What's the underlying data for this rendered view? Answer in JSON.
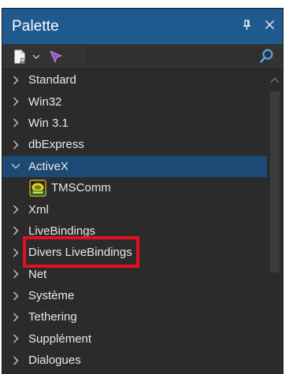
{
  "palette": {
    "title": "Palette",
    "pin_glyph": "4",
    "close_glyph": "✕"
  },
  "toolbar": {
    "icons": [
      "new-page-icon",
      "chevron-down-icon",
      "cursor-arrow-icon",
      "search-icon"
    ],
    "search_value": ""
  },
  "tree": {
    "items": [
      {
        "label": "Standard",
        "expanded": false
      },
      {
        "label": "Win32",
        "expanded": false
      },
      {
        "label": "Win 3.1",
        "expanded": false
      },
      {
        "label": "dbExpress",
        "expanded": false
      },
      {
        "label": "ActiveX",
        "expanded": true,
        "selected": true
      },
      {
        "label": "TMSComm",
        "child": true,
        "icon": "tms-comm-component-icon"
      },
      {
        "label": "Xml",
        "expanded": false
      },
      {
        "label": "LiveBindings",
        "expanded": false
      },
      {
        "label": "Divers LiveBindings",
        "expanded": false
      },
      {
        "label": "Net",
        "expanded": false
      },
      {
        "label": "Système",
        "expanded": false
      },
      {
        "label": "Tethering",
        "expanded": false
      },
      {
        "label": "Supplément",
        "expanded": false
      },
      {
        "label": "Dialogues",
        "expanded": false
      }
    ]
  },
  "colors": {
    "title_bar": "#1f5a8f",
    "panel_bg": "#2b2b2b",
    "selected_row": "#1d4a74",
    "highlight_box": "#e0121f",
    "text": "#e8e8e8"
  }
}
